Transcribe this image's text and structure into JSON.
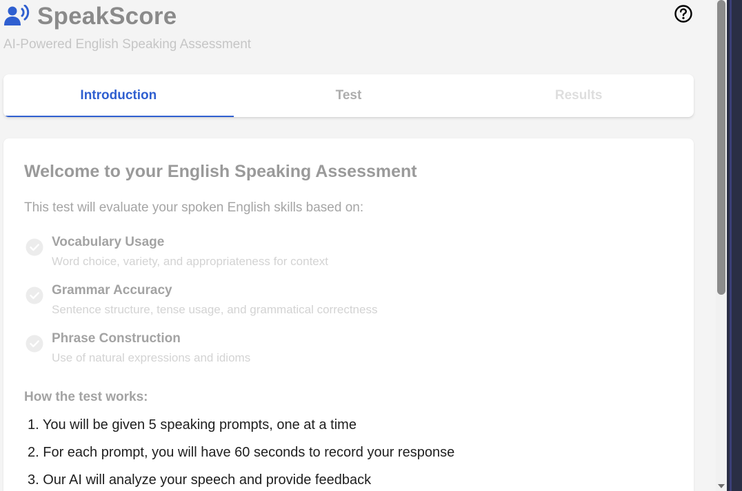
{
  "app": {
    "title": "SpeakScore",
    "subtitle": "AI-Powered English Speaking Assessment",
    "brand_icon": "voice-user-icon",
    "help_icon": "question-circle-icon",
    "accent_color": "#2f5fd0"
  },
  "tabs": [
    {
      "label": "Introduction",
      "state": "active"
    },
    {
      "label": "Test",
      "state": "enabled"
    },
    {
      "label": "Results",
      "state": "disabled"
    }
  ],
  "welcome": {
    "title": "Welcome to your English Speaking Assessment",
    "intro": "This test will evaluate your spoken English skills based on:",
    "skills": [
      {
        "title": "Vocabulary Usage",
        "description": "Word choice, variety, and appropriateness for context"
      },
      {
        "title": "Grammar Accuracy",
        "description": "Sentence structure, tense usage, and grammatical correctness"
      },
      {
        "title": "Phrase Construction",
        "description": "Use of natural expressions and idioms"
      }
    ],
    "how_title": "How the test works:",
    "steps": [
      "1. You will be given 5 speaking prompts, one at a time",
      "2. For each prompt, you will have 60 seconds to record your response",
      "3. Our AI will analyze your speech and provide feedback"
    ]
  }
}
